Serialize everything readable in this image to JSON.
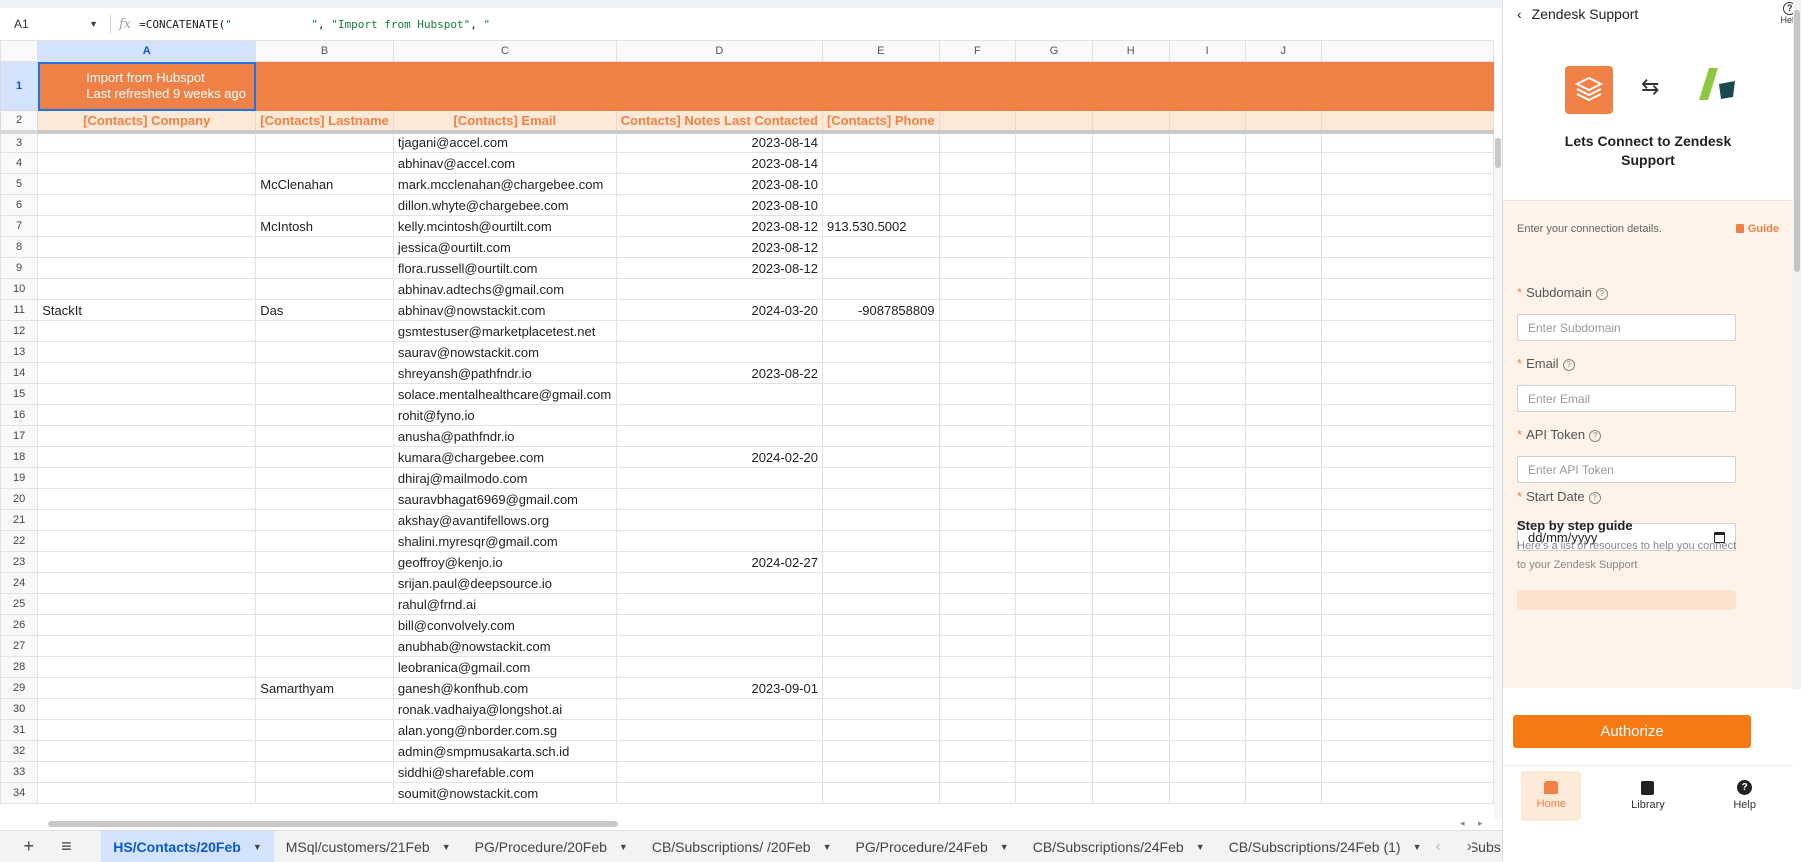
{
  "formula_bar": {
    "cell_ref": "A1",
    "formula_prefix": "=CONCATENATE(",
    "formula_str1": "\"            \"",
    "formula_mid": ", ",
    "formula_str2": "\"Import from Hubspot\"",
    "formula_mid2": ", ",
    "formula_str3": "\""
  },
  "columns": [
    "A",
    "B",
    "C",
    "D",
    "E",
    "F",
    "G",
    "H",
    "I",
    "J"
  ],
  "row1": {
    "line1": "Import from Hubspot",
    "line2": "Last refreshed 9 weeks ago"
  },
  "header_row": [
    "[Contacts] Company",
    "[Contacts] Lastname",
    "[Contacts] Email",
    "Contacts] Notes Last Contacted",
    "[Contacts] Phone",
    "",
    "",
    "",
    "",
    ""
  ],
  "rows": [
    {
      "n": "3",
      "a": "",
      "b": "",
      "c": "tjagani@accel.com",
      "d": "2023-08-14",
      "e": ""
    },
    {
      "n": "4",
      "a": "",
      "b": "",
      "c": "abhinav@accel.com",
      "d": "2023-08-14",
      "e": ""
    },
    {
      "n": "5",
      "a": "",
      "b": "McClenahan",
      "c": "mark.mcclenahan@chargebee.com",
      "d": "2023-08-10",
      "e": ""
    },
    {
      "n": "6",
      "a": "",
      "b": "",
      "c": "dillon.whyte@chargebee.com",
      "d": "2023-08-10",
      "e": ""
    },
    {
      "n": "7",
      "a": "",
      "b": "McIntosh",
      "c": "kelly.mcintosh@ourtilt.com",
      "d": "2023-08-12",
      "e": "913.530.5002"
    },
    {
      "n": "8",
      "a": "",
      "b": "",
      "c": "jessica@ourtilt.com",
      "d": "2023-08-12",
      "e": ""
    },
    {
      "n": "9",
      "a": "",
      "b": "",
      "c": "flora.russell@ourtilt.com",
      "d": "2023-08-12",
      "e": ""
    },
    {
      "n": "10",
      "a": "",
      "b": "",
      "c": "abhinav.adtechs@gmail.com",
      "d": "",
      "e": ""
    },
    {
      "n": "11",
      "a": "StackIt",
      "b": "Das",
      "c": "abhinav@nowstackit.com",
      "d": "2024-03-20",
      "e": "-9087858809"
    },
    {
      "n": "12",
      "a": "",
      "b": "",
      "c": "gsmtestuser@marketplacetest.net",
      "d": "",
      "e": ""
    },
    {
      "n": "13",
      "a": "",
      "b": "",
      "c": "saurav@nowstackit.com",
      "d": "",
      "e": ""
    },
    {
      "n": "14",
      "a": "",
      "b": "",
      "c": "shreyansh@pathfndr.io",
      "d": "2023-08-22",
      "e": ""
    },
    {
      "n": "15",
      "a": "",
      "b": "",
      "c": "solace.mentalhealthcare@gmail.com",
      "d": "",
      "e": ""
    },
    {
      "n": "16",
      "a": "",
      "b": "",
      "c": "rohit@fyno.io",
      "d": "",
      "e": ""
    },
    {
      "n": "17",
      "a": "",
      "b": "",
      "c": "anusha@pathfndr.io",
      "d": "",
      "e": ""
    },
    {
      "n": "18",
      "a": "",
      "b": "",
      "c": "kumara@chargebee.com",
      "d": "2024-02-20",
      "e": ""
    },
    {
      "n": "19",
      "a": "",
      "b": "",
      "c": "dhiraj@mailmodo.com",
      "d": "",
      "e": ""
    },
    {
      "n": "20",
      "a": "",
      "b": "",
      "c": "sauravbhagat6969@gmail.com",
      "d": "",
      "e": ""
    },
    {
      "n": "21",
      "a": "",
      "b": "",
      "c": "akshay@avantifellows.org",
      "d": "",
      "e": ""
    },
    {
      "n": "22",
      "a": "",
      "b": "",
      "c": "shalini.myresqr@gmail.com",
      "d": "",
      "e": ""
    },
    {
      "n": "23",
      "a": "",
      "b": "",
      "c": "geoffroy@kenjo.io",
      "d": "2024-02-27",
      "e": ""
    },
    {
      "n": "24",
      "a": "",
      "b": "",
      "c": "srijan.paul@deepsource.io",
      "d": "",
      "e": ""
    },
    {
      "n": "25",
      "a": "",
      "b": "",
      "c": "rahul@frnd.ai",
      "d": "",
      "e": ""
    },
    {
      "n": "26",
      "a": "",
      "b": "",
      "c": "bill@convolvely.com",
      "d": "",
      "e": ""
    },
    {
      "n": "27",
      "a": "",
      "b": "",
      "c": "anubhab@nowstackit.com",
      "d": "",
      "e": ""
    },
    {
      "n": "28",
      "a": "",
      "b": "",
      "c": "leobranica@gmail.com",
      "d": "",
      "e": ""
    },
    {
      "n": "29",
      "a": "",
      "b": "Samarthyam",
      "c": "ganesh@konfhub.com",
      "d": "2023-09-01",
      "e": ""
    },
    {
      "n": "30",
      "a": "",
      "b": "",
      "c": "ronak.vadhaiya@longshot.ai",
      "d": "",
      "e": ""
    },
    {
      "n": "31",
      "a": "",
      "b": "",
      "c": "alan.yong@nborder.com.sg",
      "d": "",
      "e": ""
    },
    {
      "n": "32",
      "a": "",
      "b": "",
      "c": "admin@smpmusakarta.sch.id",
      "d": "",
      "e": ""
    },
    {
      "n": "33",
      "a": "",
      "b": "",
      "c": "siddhi@sharefable.com",
      "d": "",
      "e": ""
    },
    {
      "n": "34",
      "a": "",
      "b": "",
      "c": "soumit@nowstackit.com",
      "d": "",
      "e": ""
    }
  ],
  "sheet_tabs": [
    {
      "label": "HS/Contacts/20Feb",
      "active": true
    },
    {
      "label": "MSql/customers/21Feb",
      "active": false
    },
    {
      "label": "PG/Procedure/20Feb",
      "active": false
    },
    {
      "label": "CB/Subscriptions/ /20Feb",
      "active": false
    },
    {
      "label": "PG/Procedure/24Feb",
      "active": false
    },
    {
      "label": "CB/Subscriptions/24Feb",
      "active": false
    },
    {
      "label": "CB/Subscriptions/24Feb (1)",
      "active": false
    },
    {
      "label": "CB/Subs",
      "active": false
    }
  ],
  "sheet_controls": {
    "add": "+",
    "all_sheets": "≡",
    "prev": "‹",
    "next": "›"
  },
  "panel": {
    "title": "Zendesk Support",
    "help_label": "Help",
    "hero_title": "Lets Connect to Zendesk Support",
    "connection_hint": "Enter your connection details.",
    "guide_label": "Guide",
    "fields": [
      {
        "label": "Subdomain",
        "placeholder": "Enter Subdomain"
      },
      {
        "label": "Email",
        "placeholder": "Enter Email"
      },
      {
        "label": "API Token",
        "placeholder": "Enter API Token"
      },
      {
        "label": "Start Date",
        "placeholder": "dd/mm/yyyy"
      }
    ],
    "step_title": "Step by step guide",
    "step_desc": "Here's a list of resources to help you connect to your Zendesk Support",
    "authorize_label": "Authorize",
    "nav": [
      {
        "label": "Home",
        "active": true
      },
      {
        "label": "Library",
        "active": false
      },
      {
        "label": "Help",
        "active": false
      }
    ],
    "accent_color": "#f57a13"
  }
}
